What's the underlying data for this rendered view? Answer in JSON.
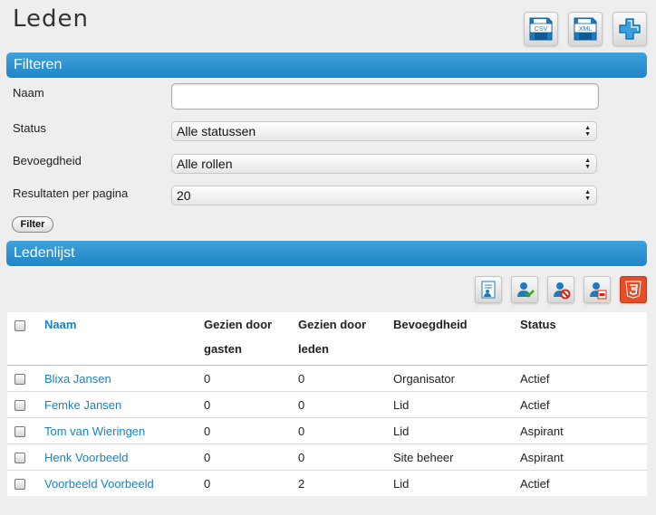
{
  "page_title": "Leden",
  "top_actions": [
    {
      "name": "export-csv-button",
      "icon": "floppy-csv-icon",
      "label": "CSV"
    },
    {
      "name": "export-xml-button",
      "icon": "floppy-xml-icon",
      "label": "XML"
    },
    {
      "name": "add-member-button",
      "icon": "plus-icon"
    }
  ],
  "filter": {
    "section_title": "Filteren",
    "name_label": "Naam",
    "name_value": "",
    "status_label": "Status",
    "status_value": "Alle statussen",
    "role_label": "Bevoegdheid",
    "role_value": "Alle rollen",
    "per_page_label": "Resultaten per pagina",
    "per_page_value": "20",
    "button_label": "Filter"
  },
  "list": {
    "section_title": "Ledenlijst",
    "actions": [
      "edit-member-icon",
      "approve-member-icon",
      "block-member-icon",
      "pdf-member-icon",
      "html5-icon"
    ],
    "columns": {
      "name": "Naam",
      "seen_guests_1": "Gezien door",
      "seen_guests_2": "gasten",
      "seen_members_1": "Gezien door",
      "seen_members_2": "leden",
      "role": "Bevoegdheid",
      "status": "Status"
    },
    "rows": [
      {
        "name": "Blixa Jansen",
        "guests": "0",
        "members": "0",
        "role": "Organisator",
        "status": "Actief"
      },
      {
        "name": "Femke Jansen",
        "guests": "0",
        "members": "0",
        "role": "Lid",
        "status": "Actief"
      },
      {
        "name": "Tom van Wieringen",
        "guests": "0",
        "members": "0",
        "role": "Lid",
        "status": "Aspirant"
      },
      {
        "name": "Henk Voorbeeld",
        "guests": "0",
        "members": "0",
        "role": "Site beheer",
        "status": "Aspirant"
      },
      {
        "name": "Voorbeeld Voorbeeld",
        "guests": "0",
        "members": "2",
        "role": "Lid",
        "status": "Actief"
      }
    ]
  }
}
